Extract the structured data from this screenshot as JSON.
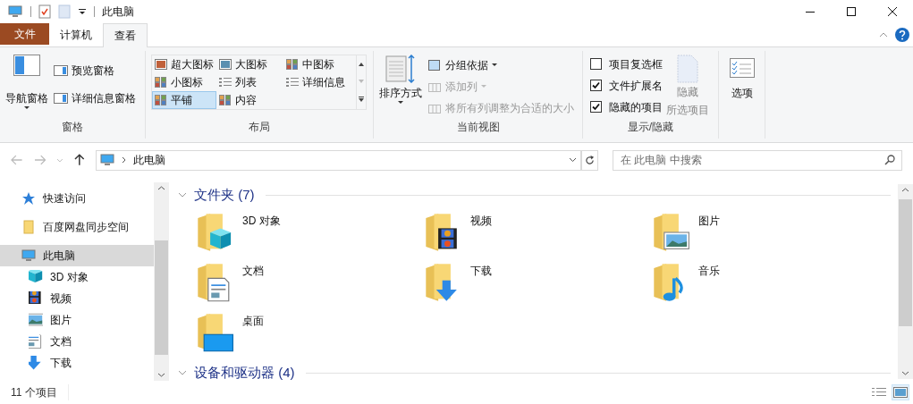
{
  "window": {
    "title": "此电脑"
  },
  "file_tab": "文件",
  "tabs": [
    {
      "label": "计算机",
      "selected": false
    },
    {
      "label": "查看",
      "selected": true
    }
  ],
  "panes_group": {
    "label": "窗格",
    "nav_pane": "导航窗格",
    "buttons": [
      "预览窗格",
      "详细信息窗格"
    ]
  },
  "layout_group": {
    "label": "布局",
    "options": [
      {
        "label": "超大图标",
        "kind": "xl",
        "selected": false
      },
      {
        "label": "大图标",
        "kind": "large",
        "selected": false
      },
      {
        "label": "中图标",
        "kind": "medium",
        "selected": false
      },
      {
        "label": "小图标",
        "kind": "small",
        "selected": false
      },
      {
        "label": "列表",
        "kind": "list",
        "selected": false
      },
      {
        "label": "详细信息",
        "kind": "details",
        "selected": false
      },
      {
        "label": "平铺",
        "kind": "tiles",
        "selected": true
      },
      {
        "label": "内容",
        "kind": "content",
        "selected": false
      }
    ]
  },
  "current_view_group": {
    "label": "当前视图",
    "sort": "排序方式",
    "actions": [
      {
        "label": "分组依据",
        "kind": "group",
        "disabled": false
      },
      {
        "label": "添加列",
        "kind": "addcol",
        "disabled": true
      },
      {
        "label": "将所有列调整为合适的大小",
        "kind": "fit",
        "disabled": true
      }
    ]
  },
  "show_hide_group": {
    "label": "显示/隐藏",
    "checkboxes": [
      {
        "label": "项目复选框",
        "checked": false
      },
      {
        "label": "文件扩展名",
        "checked": true
      },
      {
        "label": "隐藏的项目",
        "checked": true
      }
    ],
    "hide_selected": {
      "lines": [
        "隐藏",
        "所选项目"
      ],
      "disabled": true
    }
  },
  "options_button": "选项",
  "address": {
    "path": "此电脑",
    "search_placeholder": "在 此电脑 中搜索"
  },
  "sidebar": {
    "items": [
      {
        "label": "快速访问",
        "kind": "star",
        "selected": false
      },
      {
        "label": "百度网盘同步空间",
        "kind": "folder",
        "selected": false
      },
      {
        "label": "此电脑",
        "kind": "pc",
        "selected": true,
        "children": [
          {
            "label": "3D 对象",
            "kind": "cube"
          },
          {
            "label": "视频",
            "kind": "video"
          },
          {
            "label": "图片",
            "kind": "pictures"
          },
          {
            "label": "文档",
            "kind": "documents"
          },
          {
            "label": "下载",
            "kind": "downloads"
          }
        ]
      }
    ]
  },
  "sections": [
    {
      "title": "文件夹 (7)",
      "expanded": true,
      "items": [
        {
          "label": "3D 对象",
          "kind": "cube"
        },
        {
          "label": "视频",
          "kind": "video"
        },
        {
          "label": "图片",
          "kind": "pictures"
        },
        {
          "label": "文档",
          "kind": "documents"
        },
        {
          "label": "下载",
          "kind": "downloads"
        },
        {
          "label": "音乐",
          "kind": "music"
        },
        {
          "label": "桌面",
          "kind": "desktop"
        }
      ]
    },
    {
      "title": "设备和驱动器 (4)",
      "expanded": true
    }
  ],
  "status_bar": {
    "count": "11 个项目",
    "views": [
      {
        "kind": "details",
        "selected": false
      },
      {
        "kind": "tiles",
        "selected": true
      }
    ]
  }
}
